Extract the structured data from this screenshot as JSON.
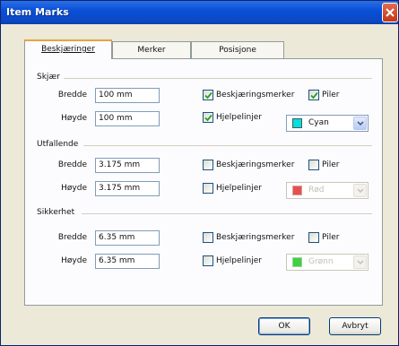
{
  "window": {
    "title": "Item Marks"
  },
  "tabs": [
    {
      "label": "Beskjæringer",
      "active": true
    },
    {
      "label": "Merker",
      "active": false
    },
    {
      "label": "Posisjone",
      "active": false
    }
  ],
  "groups": [
    {
      "name": "Skjær",
      "width_label": "Bredde",
      "width_value": "100 mm",
      "height_label": "Høyde",
      "height_value": "100 mm",
      "crop_marks_label": "Beskjæringsmerker",
      "crop_marks_checked": true,
      "arrows_label": "Piler",
      "arrows_checked": true,
      "guides_label": "Hjelpelinjer",
      "guides_checked": true,
      "color_label": "Cyan",
      "color_swatch": "#00e0e0",
      "enabled": true
    },
    {
      "name": "Utfallende",
      "width_label": "Bredde",
      "width_value": "3.175 mm",
      "height_label": "Høyde",
      "height_value": "3.175 mm",
      "crop_marks_label": "Beskjæringsmerker",
      "crop_marks_checked": false,
      "arrows_label": "Piler",
      "arrows_checked": false,
      "guides_label": "Hjelpelinjer",
      "guides_checked": false,
      "color_label": "Rød",
      "color_swatch": "#e85050",
      "enabled": false
    },
    {
      "name": "Sikkerhet",
      "width_label": "Bredde",
      "width_value": "6.35 mm",
      "height_label": "Høyde",
      "height_value": "6.35 mm",
      "crop_marks_label": "Beskjæringsmerker",
      "crop_marks_checked": false,
      "arrows_label": "Piler",
      "arrows_checked": false,
      "guides_label": "Hjelpelinjer",
      "guides_checked": false,
      "color_label": "Grønn",
      "color_swatch": "#40d040",
      "enabled": false
    }
  ],
  "buttons": {
    "ok": "OK",
    "cancel": "Avbryt"
  },
  "colors": {
    "titlebar": "#0a50d8",
    "dialog_bg": "#ece9d8",
    "tab_highlight": "#e8a43d"
  },
  "icons": {
    "close": "close-icon",
    "check": "check-icon",
    "dropdown": "chevron-down-icon"
  }
}
